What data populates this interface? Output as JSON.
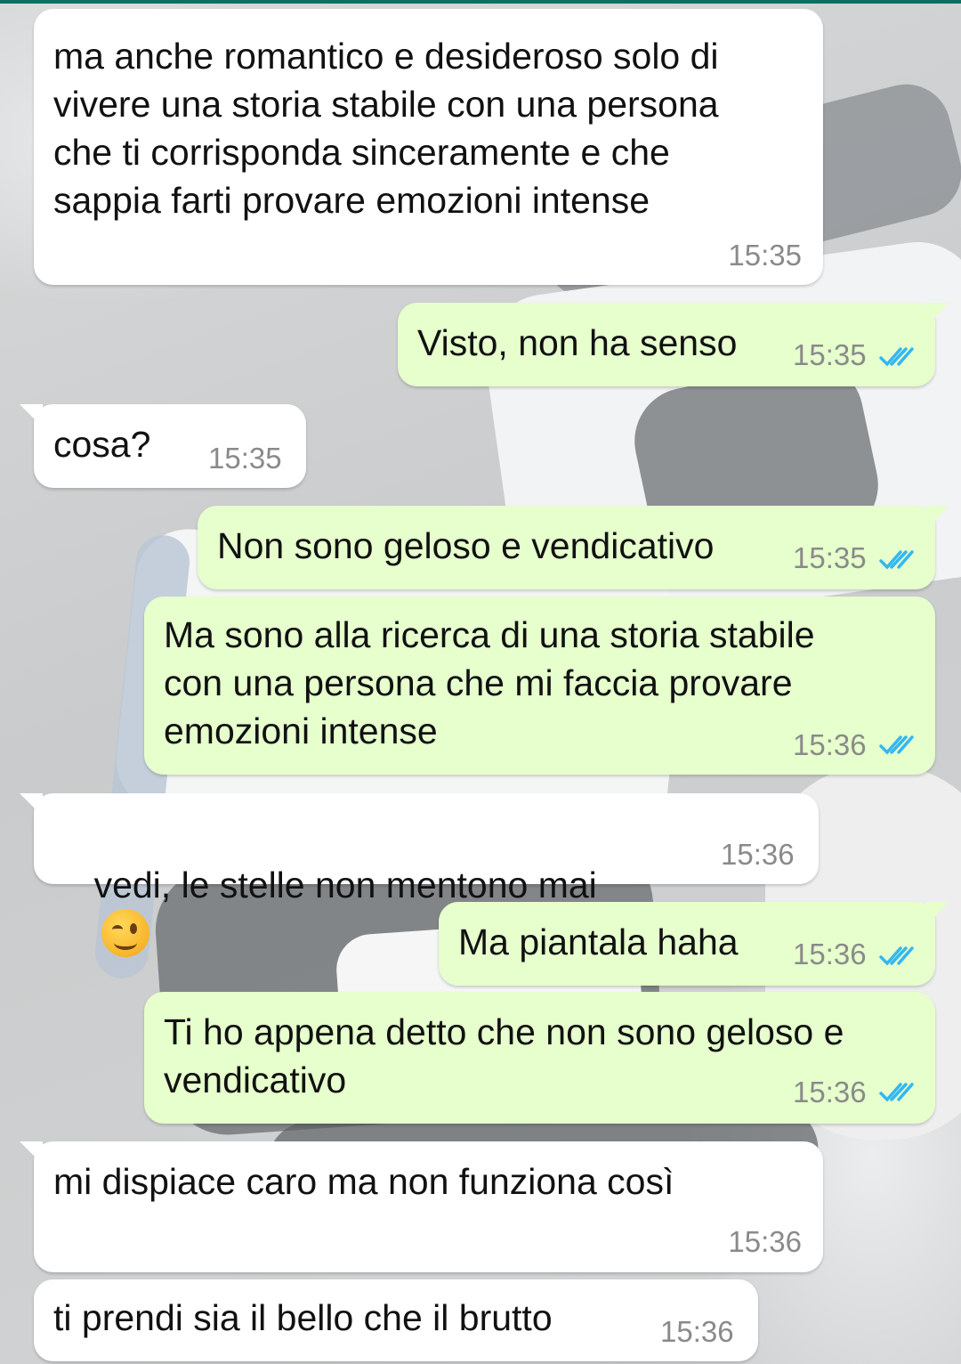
{
  "chat": {
    "messages": [
      {
        "direction": "incoming",
        "text": "ma anche romantico e desideroso solo di\nvivere una storia stabile con una persona\nche ti corrisponda sinceramente e che\nsappia farti provare emozioni intense",
        "time": "15:35"
      },
      {
        "direction": "outgoing",
        "text": "Visto, non ha senso",
        "time": "15:35",
        "status": "read"
      },
      {
        "direction": "incoming",
        "text": "cosa?",
        "time": "15:35"
      },
      {
        "direction": "outgoing",
        "text": "Non sono geloso e vendicativo",
        "time": "15:35",
        "status": "read"
      },
      {
        "direction": "outgoing",
        "text": "Ma sono alla ricerca di una storia stabile\ncon una persona che mi faccia provare\nemozioni intense",
        "time": "15:36",
        "status": "read"
      },
      {
        "direction": "incoming",
        "text": "vedi, le stelle non mentono mai",
        "emoji": "winking-face",
        "time": "15:36"
      },
      {
        "direction": "outgoing",
        "text": "Ma piantala haha",
        "time": "15:36",
        "status": "read"
      },
      {
        "direction": "outgoing",
        "text": "Ti ho appena detto che non sono geloso e\nvendicativo",
        "time": "15:36",
        "status": "read"
      },
      {
        "direction": "incoming",
        "text": "mi dispiace caro ma non funziona così",
        "time": "15:36"
      },
      {
        "direction": "incoming",
        "text": "ti prendi sia il bello che il brutto",
        "time": "15:36"
      }
    ]
  },
  "colors": {
    "incoming_bubble": "#ffffff",
    "outgoing_bubble": "#e6ffcd",
    "read_ticks": "#34b7f1",
    "timestamp": "#8a8a8a",
    "top_bar": "#0f6e62"
  },
  "icons": {
    "read_receipt": "double-check-icon",
    "emoji": "winking-face-emoji"
  }
}
